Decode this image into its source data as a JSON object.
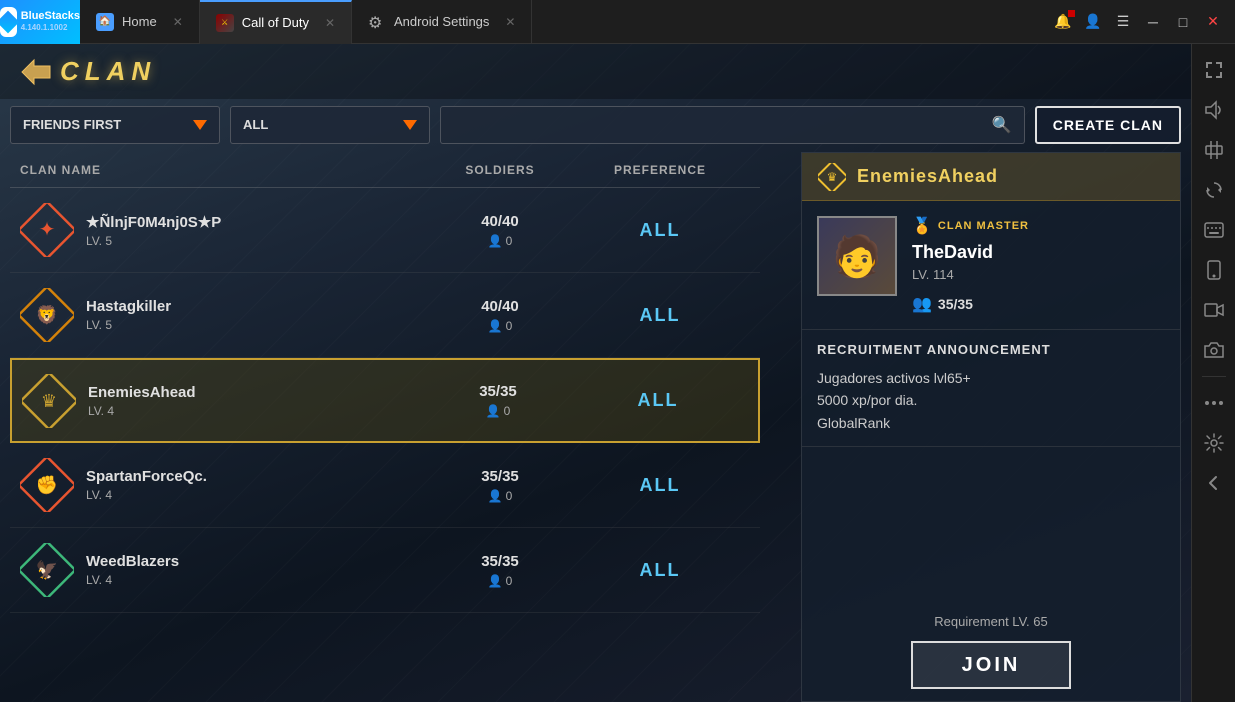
{
  "app": {
    "name": "BlueStacks",
    "version": "4.140.1.1002"
  },
  "titlebar": {
    "tabs": [
      {
        "label": "Home",
        "icon": "home",
        "active": false
      },
      {
        "label": "Call of Duty",
        "icon": "cod",
        "active": true
      },
      {
        "label": "Android Settings",
        "icon": "settings",
        "active": false
      }
    ],
    "controls": [
      "minimize",
      "maximize",
      "close"
    ]
  },
  "clan": {
    "title": "CLAN",
    "filters": {
      "sort": "FRIENDS FIRST",
      "type": "ALL",
      "search_placeholder": ""
    },
    "create_button": "CREATE CLAN",
    "columns": {
      "clan_name": "CLAN NAME",
      "soldiers": "SOLDIERS",
      "preference": "PREFERENCE"
    },
    "clans": [
      {
        "name": "★ÑlnjF0M4nj0S★P",
        "level": "LV. 5",
        "soldiers": "40/40",
        "requests": "0",
        "preference": "ALL",
        "color": "red",
        "selected": false
      },
      {
        "name": "Hastagkiller",
        "level": "LV. 5",
        "soldiers": "40/40",
        "requests": "0",
        "preference": "ALL",
        "color": "orange",
        "selected": false
      },
      {
        "name": "EnemiesAhead",
        "level": "LV. 4",
        "soldiers": "35/35",
        "requests": "0",
        "preference": "ALL",
        "color": "gold",
        "selected": true
      },
      {
        "name": "SpartanForceQc.",
        "level": "LV. 4",
        "soldiers": "35/35",
        "requests": "0",
        "preference": "ALL",
        "color": "red",
        "selected": false
      },
      {
        "name": "WeedBlazers",
        "level": "LV. 4",
        "soldiers": "35/35",
        "requests": "0",
        "preference": "ALL",
        "color": "green",
        "selected": false
      }
    ]
  },
  "detail": {
    "clan_name": "EnemiesAhead",
    "master_badge": "CLAN MASTER",
    "master_name": "TheDavid",
    "master_level": "LV. 114",
    "members": "35/35",
    "recruitment_title": "RECRUITMENT ANNOUNCEMENT",
    "recruitment_text": "Jugadores activos lvl65+\n5000 xp/por dia.\nGlobalRank",
    "requirement": "Requirement LV. 65",
    "join_button": "JOIN"
  },
  "sidebar_tools": [
    "expand-icon",
    "volume-icon",
    "resize-icon",
    "rotate-icon",
    "keyboard-icon",
    "phone-icon",
    "video-icon",
    "camera-icon",
    "more-icon",
    "settings-icon",
    "back-icon"
  ]
}
